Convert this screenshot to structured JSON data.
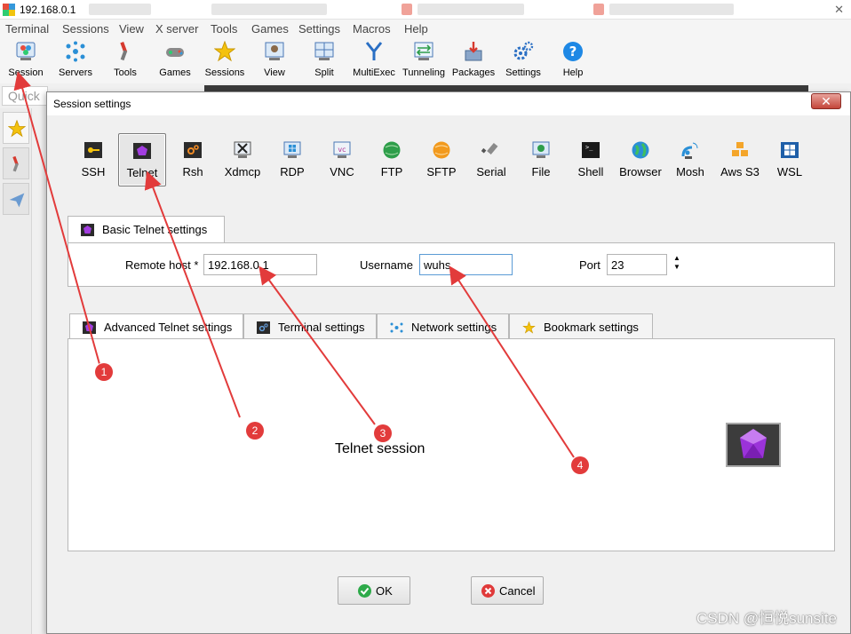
{
  "window": {
    "title": "192.168.0.1",
    "close_glyph": "✕"
  },
  "menubar": [
    "Terminal",
    "Sessions",
    "View",
    "X server",
    "Tools",
    "Games",
    "Settings",
    "Macros",
    "Help"
  ],
  "toolbar": [
    {
      "label": "Session",
      "icon": "session-icon"
    },
    {
      "label": "Servers",
      "icon": "servers-icon"
    },
    {
      "label": "Tools",
      "icon": "tools-icon"
    },
    {
      "label": "Games",
      "icon": "games-icon"
    },
    {
      "label": "Sessions",
      "icon": "star-icon"
    },
    {
      "label": "View",
      "icon": "view-icon"
    },
    {
      "label": "Split",
      "icon": "split-icon"
    },
    {
      "label": "MultiExec",
      "icon": "multiexec-icon"
    },
    {
      "label": "Tunneling",
      "icon": "tunneling-icon"
    },
    {
      "label": "Packages",
      "icon": "packages-icon"
    },
    {
      "label": "Settings",
      "icon": "gear-icon"
    },
    {
      "label": "Help",
      "icon": "help-icon"
    }
  ],
  "quick_connect": {
    "placeholder": "Quick"
  },
  "dialog": {
    "title": "Session settings",
    "close_glyph": "✕",
    "session_types": [
      "SSH",
      "Telnet",
      "Rsh",
      "Xdmcp",
      "RDP",
      "VNC",
      "FTP",
      "SFTP",
      "Serial",
      "File",
      "Shell",
      "Browser",
      "Mosh",
      "Aws S3",
      "WSL"
    ],
    "selected_type": "Telnet",
    "basic_tab": {
      "label": "Basic Telnet settings"
    },
    "fields": {
      "remote_host_label": "Remote host *",
      "remote_host_value": "192.168.0.1",
      "username_label": "Username",
      "username_value": "wuhs",
      "port_label": "Port",
      "port_value": "23"
    },
    "adv_tabs": [
      "Advanced Telnet settings",
      "Terminal settings",
      "Network settings",
      "Bookmark settings"
    ],
    "session_label": "Telnet session",
    "ok_label": "OK",
    "cancel_label": "Cancel"
  },
  "watermark": "CSDN @恒悦sunsite",
  "annotations": [
    "1",
    "2",
    "3",
    "4"
  ],
  "colors": {
    "accent_red": "#e23b3b",
    "selection_border": "#7a7a7a",
    "focus_blue": "#5b9bd5"
  }
}
